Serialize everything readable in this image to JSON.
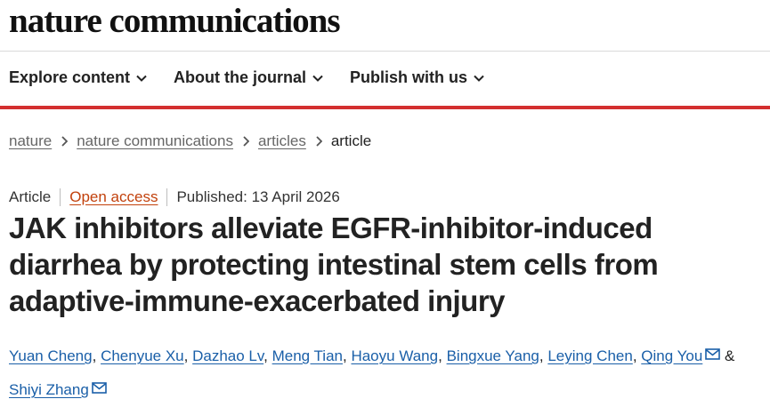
{
  "site": {
    "title": "nature communications",
    "nav": [
      {
        "label": "Explore content"
      },
      {
        "label": "About the journal"
      },
      {
        "label": "Publish with us"
      }
    ]
  },
  "breadcrumb": {
    "items": [
      "nature",
      "nature communications",
      "articles"
    ],
    "current": "article"
  },
  "article": {
    "type": "Article",
    "access": "Open access",
    "published": "Published: 13 April 2026",
    "title": "JAK inhibitors alleviate EGFR-inhibitor-induced diarrhea by protecting intestinal stem cells from adaptive-immune-exacerbated injury",
    "authors": [
      "Yuan Cheng",
      "Chenyue Xu",
      "Dazhao Lv",
      "Meng Tian",
      "Haoyu Wang",
      "Bingxue Yang",
      "Leying Chen",
      "Qing You",
      "Shiyi Zhang"
    ],
    "author_separator": ",",
    "last_separator": "&"
  },
  "colors": {
    "accent_rule": "#d32f2f",
    "link": "#1a5fa8",
    "open_access": "#c2410c",
    "breadcrumb_link": "#666666"
  },
  "icons": {
    "nav_dropdown": "chevron-down-icon",
    "breadcrumb_separator": "chevron-right-icon",
    "corresponding_author": "mail-icon"
  }
}
